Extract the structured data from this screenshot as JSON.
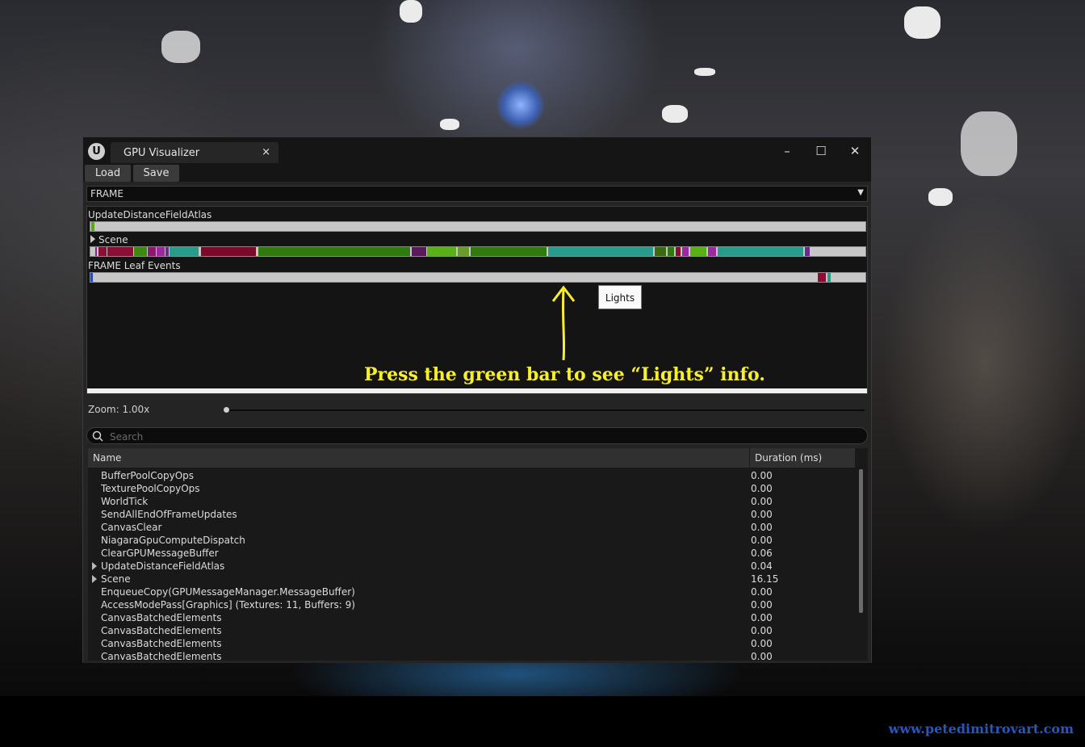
{
  "window": {
    "tab_title": "GPU Visualizer",
    "tab_close": "×",
    "minimize": "–",
    "maximize": "☐",
    "close": "✕",
    "logo": "U"
  },
  "toolbar": {
    "load_label": "Load",
    "save_label": "Save"
  },
  "frame_selector": {
    "value": "FRAME"
  },
  "timeline": {
    "track1_label": "UpdateDistanceFieldAtlas",
    "track2_label": "Scene",
    "track3_label": "FRAME Leaf Events",
    "tooltip": "Lights",
    "annotation": "Press the green bar to see “Lights” info."
  },
  "zoom": {
    "label": "Zoom: 1.00x",
    "value": 1.0
  },
  "search": {
    "placeholder": "Search",
    "value": ""
  },
  "table": {
    "col_name": "Name",
    "col_duration": "Duration (ms)",
    "rows": [
      {
        "name": "BufferPoolCopyOps",
        "duration": "0.00",
        "expandable": false
      },
      {
        "name": "TexturePoolCopyOps",
        "duration": "0.00",
        "expandable": false
      },
      {
        "name": "WorldTick",
        "duration": "0.00",
        "expandable": false
      },
      {
        "name": "SendAllEndOfFrameUpdates",
        "duration": "0.00",
        "expandable": false
      },
      {
        "name": "CanvasClear",
        "duration": "0.00",
        "expandable": false
      },
      {
        "name": "NiagaraGpuComputeDispatch",
        "duration": "0.00",
        "expandable": false
      },
      {
        "name": "ClearGPUMessageBuffer",
        "duration": "0.06",
        "expandable": false
      },
      {
        "name": "UpdateDistanceFieldAtlas",
        "duration": "0.04",
        "expandable": true
      },
      {
        "name": "Scene",
        "duration": "16.15",
        "expandable": true
      },
      {
        "name": "EnqueueCopy(GPUMessageManager.MessageBuffer)",
        "duration": "0.00",
        "expandable": false
      },
      {
        "name": "AccessModePass[Graphics] (Textures: 11, Buffers: 9)",
        "duration": "0.00",
        "expandable": false
      },
      {
        "name": "CanvasBatchedElements",
        "duration": "0.00",
        "expandable": false
      },
      {
        "name": "CanvasBatchedElements",
        "duration": "0.00",
        "expandable": false
      },
      {
        "name": "CanvasBatchedElements",
        "duration": "0.00",
        "expandable": false
      },
      {
        "name": "CanvasBatchedElements",
        "duration": "0.00",
        "expandable": false
      }
    ]
  },
  "credit": "www.petedimitrovart.com",
  "colors": {
    "annotation": "#f7ef2a",
    "green": "#3c8a12",
    "teal": "#2a9a8a",
    "crimson": "#8a0f35",
    "purple": "#7a2a8a"
  }
}
